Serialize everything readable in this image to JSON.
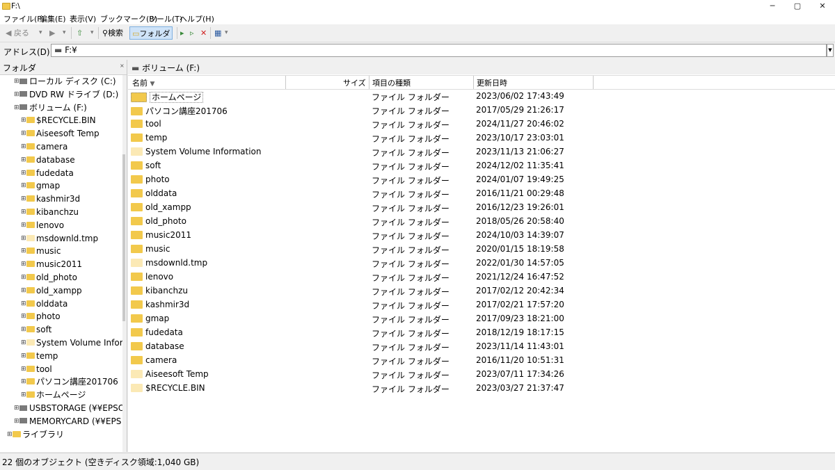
{
  "window": {
    "title": "F:\\"
  },
  "window_controls": {
    "minimize": "─",
    "maximize": "▢",
    "close": "✕"
  },
  "menu": [
    "ファイル(F)",
    "編集(E)",
    "表示(V)",
    "ブックマーク(B)",
    "ツール(T)",
    "ヘルプ(H)"
  ],
  "toolbar": {
    "back": "戻る",
    "search": "検索",
    "folders": "フォルダ"
  },
  "address": {
    "label": "アドレス(D)",
    "value": "F:¥"
  },
  "left_pane": {
    "title": "フォルダ",
    "close": "×",
    "tree": [
      {
        "label": "ローカル ディスク (C:)",
        "level": 1,
        "kind": "drive"
      },
      {
        "label": "DVD RW ドライブ (D:)",
        "level": 1,
        "kind": "drive"
      },
      {
        "label": "ボリューム (F:)",
        "level": 1,
        "kind": "drive"
      },
      {
        "label": "$RECYCLE.BIN",
        "level": 2,
        "kind": "folder"
      },
      {
        "label": "Aiseesoft Temp",
        "level": 2,
        "kind": "folder"
      },
      {
        "label": "camera",
        "level": 2,
        "kind": "folder"
      },
      {
        "label": "database",
        "level": 2,
        "kind": "folder"
      },
      {
        "label": "fudedata",
        "level": 2,
        "kind": "folder"
      },
      {
        "label": "gmap",
        "level": 2,
        "kind": "folder"
      },
      {
        "label": "kashmir3d",
        "level": 2,
        "kind": "folder"
      },
      {
        "label": "kibanchzu",
        "level": 2,
        "kind": "folder"
      },
      {
        "label": "lenovo",
        "level": 2,
        "kind": "folder"
      },
      {
        "label": "msdownld.tmp",
        "level": 2,
        "kind": "folder"
      },
      {
        "label": "music",
        "level": 2,
        "kind": "folder"
      },
      {
        "label": "music2011",
        "level": 2,
        "kind": "folder"
      },
      {
        "label": "old_photo",
        "level": 2,
        "kind": "folder"
      },
      {
        "label": "old_xampp",
        "level": 2,
        "kind": "folder"
      },
      {
        "label": "olddata",
        "level": 2,
        "kind": "folder"
      },
      {
        "label": "photo",
        "level": 2,
        "kind": "folder"
      },
      {
        "label": "soft",
        "level": 2,
        "kind": "folder"
      },
      {
        "label": "System Volume Infor",
        "level": 2,
        "kind": "folder"
      },
      {
        "label": "temp",
        "level": 2,
        "kind": "folder"
      },
      {
        "label": "tool",
        "level": 2,
        "kind": "folder"
      },
      {
        "label": "パソコン講座201706",
        "level": 2,
        "kind": "folder"
      },
      {
        "label": "ホームページ",
        "level": 2,
        "kind": "folder"
      },
      {
        "label": "USBSTORAGE (¥¥EPSO",
        "level": 1,
        "kind": "drive"
      },
      {
        "label": "MEMORYCARD (¥¥EPS",
        "level": 1,
        "kind": "drive"
      },
      {
        "label": "ライブラリ",
        "level": 0,
        "kind": "folder"
      }
    ]
  },
  "right_pane": {
    "tab_title": "ボリューム (F:)",
    "columns": {
      "name": "名前",
      "size": "サイズ",
      "type": "項目の種類",
      "modified": "更新日時"
    },
    "rows": [
      {
        "name": "ホームページ",
        "type": "ファイル フォルダー",
        "modified": "2023/06/02 17:43:49"
      },
      {
        "name": "パソコン講座201706",
        "type": "ファイル フォルダー",
        "modified": "2017/05/29 21:26:17"
      },
      {
        "name": "tool",
        "type": "ファイル フォルダー",
        "modified": "2024/11/27 20:46:02"
      },
      {
        "name": "temp",
        "type": "ファイル フォルダー",
        "modified": "2023/10/17 23:03:01"
      },
      {
        "name": "System Volume Information",
        "type": "ファイル フォルダー",
        "modified": "2023/11/13 21:06:27"
      },
      {
        "name": "soft",
        "type": "ファイル フォルダー",
        "modified": "2024/12/02 11:35:41"
      },
      {
        "name": "photo",
        "type": "ファイル フォルダー",
        "modified": "2024/01/07 19:49:25"
      },
      {
        "name": "olddata",
        "type": "ファイル フォルダー",
        "modified": "2016/11/21 00:29:48"
      },
      {
        "name": "old_xampp",
        "type": "ファイル フォルダー",
        "modified": "2016/12/23 19:26:01"
      },
      {
        "name": "old_photo",
        "type": "ファイル フォルダー",
        "modified": "2018/05/26 20:58:40"
      },
      {
        "name": "music2011",
        "type": "ファイル フォルダー",
        "modified": "2024/10/03 14:39:07"
      },
      {
        "name": "music",
        "type": "ファイル フォルダー",
        "modified": "2020/01/15 18:19:58"
      },
      {
        "name": "msdownld.tmp",
        "type": "ファイル フォルダー",
        "modified": "2022/01/30 14:57:05"
      },
      {
        "name": "lenovo",
        "type": "ファイル フォルダー",
        "modified": "2021/12/24 16:47:52"
      },
      {
        "name": "kibanchzu",
        "type": "ファイル フォルダー",
        "modified": "2017/02/12 20:42:34"
      },
      {
        "name": "kashmir3d",
        "type": "ファイル フォルダー",
        "modified": "2017/02/21 17:57:20"
      },
      {
        "name": "gmap",
        "type": "ファイル フォルダー",
        "modified": "2017/09/23 18:21:00"
      },
      {
        "name": "fudedata",
        "type": "ファイル フォルダー",
        "modified": "2018/12/19 18:17:15"
      },
      {
        "name": "database",
        "type": "ファイル フォルダー",
        "modified": "2023/11/14 11:43:01"
      },
      {
        "name": "camera",
        "type": "ファイル フォルダー",
        "modified": "2016/11/20 10:51:31"
      },
      {
        "name": "Aiseesoft Temp",
        "type": "ファイル フォルダー",
        "modified": "2023/07/11 17:34:26"
      },
      {
        "name": "$RECYCLE.BIN",
        "type": "ファイル フォルダー",
        "modified": "2023/03/27 21:37:47"
      }
    ]
  },
  "status": {
    "text": "22 個のオブジェクト (空きディスク領域:1,040 GB)"
  }
}
